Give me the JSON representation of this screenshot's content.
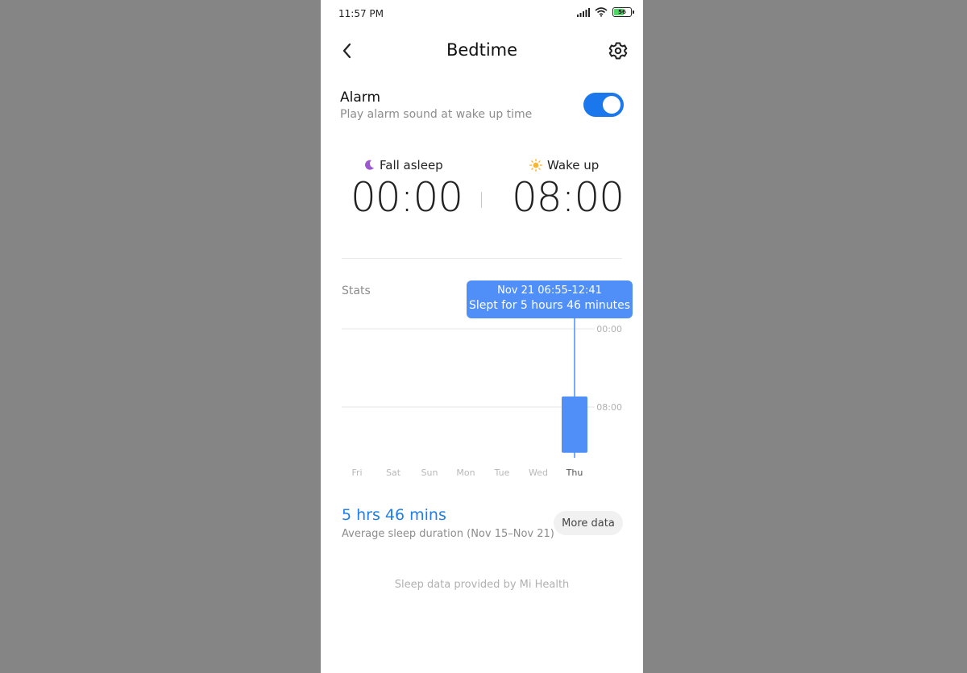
{
  "status_bar": {
    "time": "11:57 PM",
    "battery": "56"
  },
  "header": {
    "title": "Bedtime"
  },
  "alarm": {
    "title": "Alarm",
    "subtitle": "Play alarm sound at wake up time",
    "enabled": true
  },
  "schedule": {
    "fall_asleep": {
      "label": "Fall asleep",
      "time": "00:00"
    },
    "wake_up": {
      "label": "Wake up",
      "time": "08:00"
    }
  },
  "stats": {
    "label": "Stats",
    "tooltip": {
      "date_range": "Nov 21 06:55-12:41",
      "summary": "Slept for 5 hours 46 minutes"
    }
  },
  "chart_data": {
    "type": "bar",
    "categories": [
      "Fri",
      "Sat",
      "Sun",
      "Mon",
      "Tue",
      "Wed",
      "Thu"
    ],
    "y_ticks": [
      "00:00",
      "08:00"
    ],
    "selected": "Thu",
    "series": [
      {
        "values": [
          null,
          null,
          null,
          null,
          null,
          null,
          {
            "start": "06:55",
            "end": "12:41"
          }
        ]
      }
    ]
  },
  "summary": {
    "average": "5 hrs 46 mins",
    "label": "Average sleep duration (Nov 15–Nov 21)",
    "more_button": "More data"
  },
  "footer": {
    "note": "Sleep data provided by Mi Health"
  },
  "colors": {
    "accent": "#1b77ec",
    "bar": "#4f8ff7",
    "link": "#1f7fe6"
  }
}
